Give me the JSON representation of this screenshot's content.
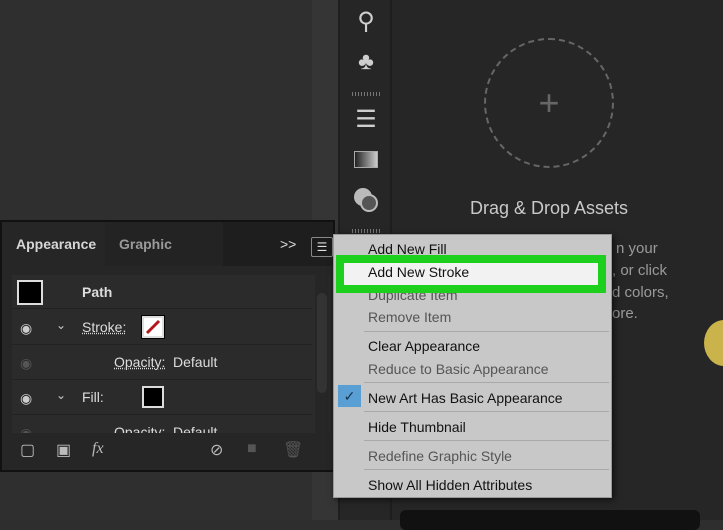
{
  "assets": {
    "title": "Drag & Drop Assets",
    "fragments": [
      "n your",
      ", or click",
      "d colors,",
      "ore."
    ]
  },
  "toolbar_icons": [
    "brush-bucket-icon",
    "club-icon",
    "lines-icon",
    "gradient-icon",
    "transparency-icon"
  ],
  "panel": {
    "tabs": [
      {
        "label": "Appearance",
        "active": true
      },
      {
        "label": "Graphic Styles",
        "active": false
      }
    ],
    "more_label": ">>",
    "header": "Path",
    "rows": [
      {
        "label": "Stroke:",
        "swatch": "none-red-slash"
      },
      {
        "label": "Opacity:",
        "value": "Default"
      },
      {
        "label": "Fill:",
        "swatch": "black"
      },
      {
        "label": "Opacity:",
        "value": "Default"
      }
    ],
    "fx_label": "fx"
  },
  "menu": {
    "items": [
      {
        "label": "Add New Fill",
        "enabled": true
      },
      {
        "label": "Add New Stroke",
        "enabled": true,
        "highlighted": true
      },
      {
        "label": "Duplicate Item",
        "enabled": false
      },
      {
        "label": "Remove Item",
        "enabled": false
      },
      {
        "label": "Clear Appearance",
        "enabled": true
      },
      {
        "label": "Reduce to Basic Appearance",
        "enabled": false
      },
      {
        "label": "New Art Has Basic Appearance",
        "enabled": true,
        "checked": true
      },
      {
        "label": "Hide Thumbnail",
        "enabled": true
      },
      {
        "label": "Redefine Graphic Style",
        "enabled": false
      },
      {
        "label": "Show All Hidden Attributes",
        "enabled": true
      }
    ]
  },
  "colors": {
    "highlight": "#1ed01e",
    "check": "#5a9fd4"
  }
}
